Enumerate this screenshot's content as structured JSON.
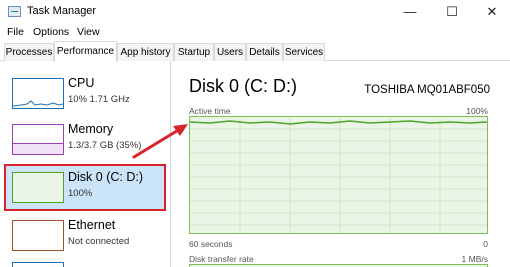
{
  "window": {
    "title": "Task Manager",
    "minimize": "—",
    "maximize": "☐",
    "close": "✕"
  },
  "menu": [
    "File",
    "Options",
    "View"
  ],
  "tabs": [
    "Processes",
    "Performance",
    "App history",
    "Startup",
    "Users",
    "Details",
    "Services"
  ],
  "sidebar": [
    {
      "name": "CPU",
      "detail": "10% 1.71 GHz"
    },
    {
      "name": "Memory",
      "detail": "1.3/3.7 GB (35%)"
    },
    {
      "name": "Disk 0 (C: D:)",
      "detail": "100%"
    },
    {
      "name": "Ethernet",
      "detail": "Not connected"
    }
  ],
  "main": {
    "title": "Disk 0 (C: D:)",
    "model": "TOSHIBA MQ01ABF050",
    "active_time_label": "Active time",
    "active_time_max": "100%",
    "time_span": "60 seconds",
    "min_value": "0",
    "transfer_label": "Disk transfer rate",
    "transfer_max": "1 MB/s"
  },
  "colors": {
    "cpu": "#1f6fb5",
    "memory": "#9a3fb2",
    "disk": "#4da42a",
    "ethernet": "#a0522d",
    "selection": "#cce4f7",
    "annotation": "#d9232b"
  }
}
